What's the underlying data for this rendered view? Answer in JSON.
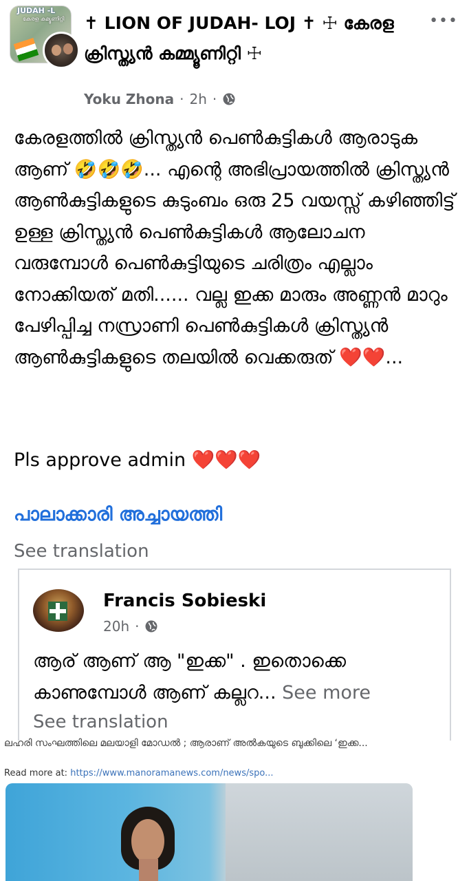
{
  "header": {
    "group_avatar_text": "JUDAH -L",
    "group_title": "✝ LION OF JUDAH- LOJ ✝ ☩ കേരള ക്രിസ്ത്യൻ കമ്മ്യൂണിറ്റി ☩",
    "author": "Yoku Zhona",
    "time": "2h",
    "separator": "·",
    "more_label": "•••"
  },
  "post": {
    "text": "കേരളത്തിൽ ക്രിസ്ത്യൻ പെൺകുട്ടികൾ ആരാടുക ആണ് 🤣🤣🤣... എന്റെ അഭിപ്രായത്തിൽ ക്രിസ്ത്യൻ ആൺകുട്ടികളുടെ കുടുംബം ഒരു 25 വയസ്സ് കഴിഞ്ഞിട്ട് ഉള്ള ക്രിസ്ത്യൻ പെൺകുട്ടികൾ ആലോചന വരുമ്പോൾ പെൺകുട്ടിയുടെ ചരിത്രം എല്ലാം നോക്കിയത് മതി...... വല്ല ഇക്ക മാരും അണ്ണൻ മാറും പേഴിപ്പിച്ച നസ്രാണി പെൺകുട്ടികൾ ക്രിസ്ത്യൻ ആൺകുട്ടികളുടെ തലയിൽ വെക്കരുത് ❤️❤️...",
    "approve_text": "Pls approve admin ❤️❤️❤️",
    "hashtag": "പാലാക്കാരി അച്ചായത്തി",
    "see_translation": "See translation"
  },
  "shared": {
    "name": "Francis Sobieski",
    "time": "20h",
    "separator": "·",
    "text": "ആര് ആണ് ആ \"ഇക്ക\" . ഇതൊക്കെ കാണുമ്പോൾ ആണ് കല്ലറ...",
    "see_more": "See more",
    "see_translation": "See translation"
  },
  "link": {
    "headline": "ലഹരി സംഘത്തിലെ മലയാളി മോഡൽ ; ആരാണ് അൽകയുടെ ബുക്കിലെ ‘ഇക്ക...",
    "read_more_label": "Read more at:",
    "url": "https://www.manoramanews.com/news/spo..."
  }
}
